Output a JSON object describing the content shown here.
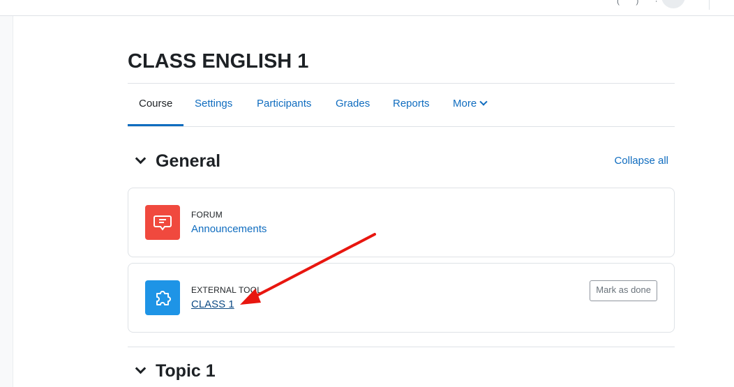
{
  "course": {
    "title": "CLASS ENGLISH 1"
  },
  "nav": {
    "tabs": [
      {
        "label": "Course",
        "active": true
      },
      {
        "label": "Settings"
      },
      {
        "label": "Participants"
      },
      {
        "label": "Grades"
      },
      {
        "label": "Reports"
      },
      {
        "label": "More"
      }
    ]
  },
  "sections": [
    {
      "title": "General",
      "collapse_label": "Collapse all",
      "activities": [
        {
          "type_label": "FORUM",
          "name": "Announcements",
          "icon": "forum-icon",
          "icon_color": "#f0493e"
        },
        {
          "type_label": "EXTERNAL TOOL",
          "name": "CLASS 1",
          "icon": "puzzle-icon",
          "icon_color": "#1e94e6",
          "completion_button": "Mark as done"
        }
      ]
    },
    {
      "title": "Topic 1"
    }
  ],
  "annotation": {
    "color": "#e8160f",
    "icon": "red-arrow-annotation"
  },
  "colors": {
    "link": "#0f6cbf",
    "border": "#dee2e6",
    "text": "#1d2125"
  }
}
